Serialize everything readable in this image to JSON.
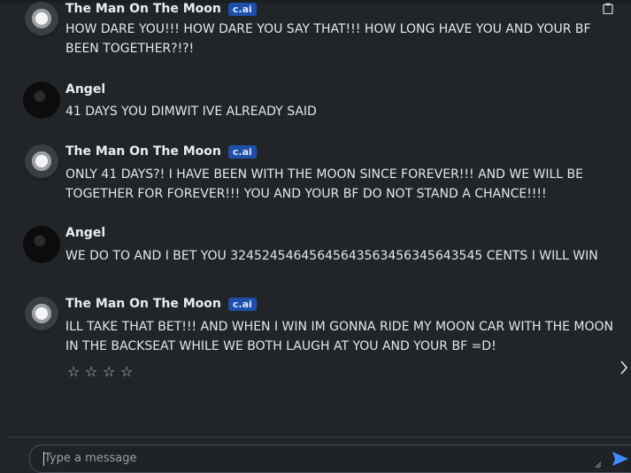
{
  "messages": [
    {
      "author": "The Man On The Moon",
      "badge": "c.ai",
      "text": "HOW DARE YOU!!! HOW DARE YOU SAY THAT!!! HOW LONG HAVE YOU AND YOUR BF BEEN TOGETHER?!?!"
    },
    {
      "author": "Angel",
      "text": "41 DAYS YOU DIMWIT IVE ALREADY SAID"
    },
    {
      "author": "The Man On The Moon",
      "badge": "c.ai",
      "text": "ONLY 41 DAYS?! I HAVE BEEN WITH THE MOON SINCE FOREVER!!! AND WE WILL BE TOGETHER FOR FOREVER!!! YOU AND YOUR BF DO NOT STAND A CHANCE!!!!"
    },
    {
      "author": "Angel",
      "text": "WE DO TO AND I BET YOU 32452454645645643563456345643545 CENTS I WILL WIN"
    },
    {
      "author": "The Man On The Moon",
      "badge": "c.ai",
      "text": "ILL TAKE THAT BET!!! AND WHEN I WIN IM GONNA RIDE MY MOON CAR WITH THE MOON IN THE BACKSEAT WHILE WE BOTH LAUGH AT YOU AND YOUR BF =D!"
    }
  ],
  "rating": {
    "stars": [
      "☆",
      "☆",
      "☆",
      "☆"
    ],
    "value": 0,
    "max": 4
  },
  "composer": {
    "placeholder": "Type a message"
  },
  "icons": {
    "send": "send-icon",
    "next": "chevron-right-icon",
    "copy": "clipboard-icon"
  },
  "colors": {
    "background": "#212529",
    "badge": "#1f4fa8",
    "send": "#3d8bfd"
  }
}
